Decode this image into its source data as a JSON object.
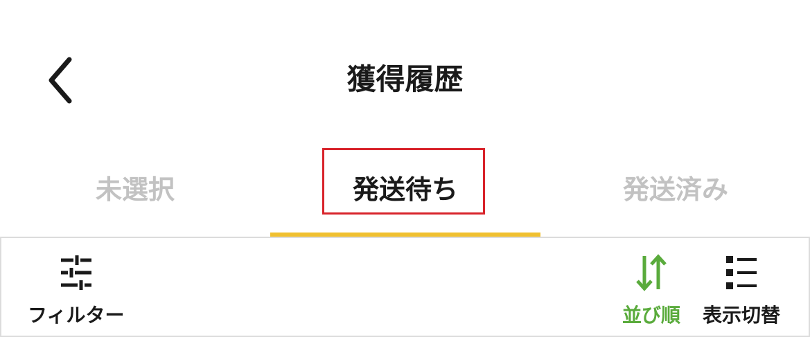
{
  "header": {
    "back_icon": "chevron-left-icon",
    "title": "獲得履歴"
  },
  "tabs": [
    {
      "label": "未選択",
      "active": false
    },
    {
      "label": "発送待ち",
      "active": true
    },
    {
      "label": "発送済み",
      "active": false
    }
  ],
  "colors": {
    "active_underline": "#f0c030",
    "highlight_box": "#d8232a",
    "sort_accent": "#5aab3c",
    "inactive_tab": "#c2c2c2"
  },
  "toolbar": {
    "filter": {
      "label": "フィルター",
      "icon": "sliders-icon"
    },
    "sort": {
      "label": "並び順",
      "icon": "sort-arrows-icon"
    },
    "view": {
      "label": "表示切替",
      "icon": "list-view-icon"
    }
  }
}
